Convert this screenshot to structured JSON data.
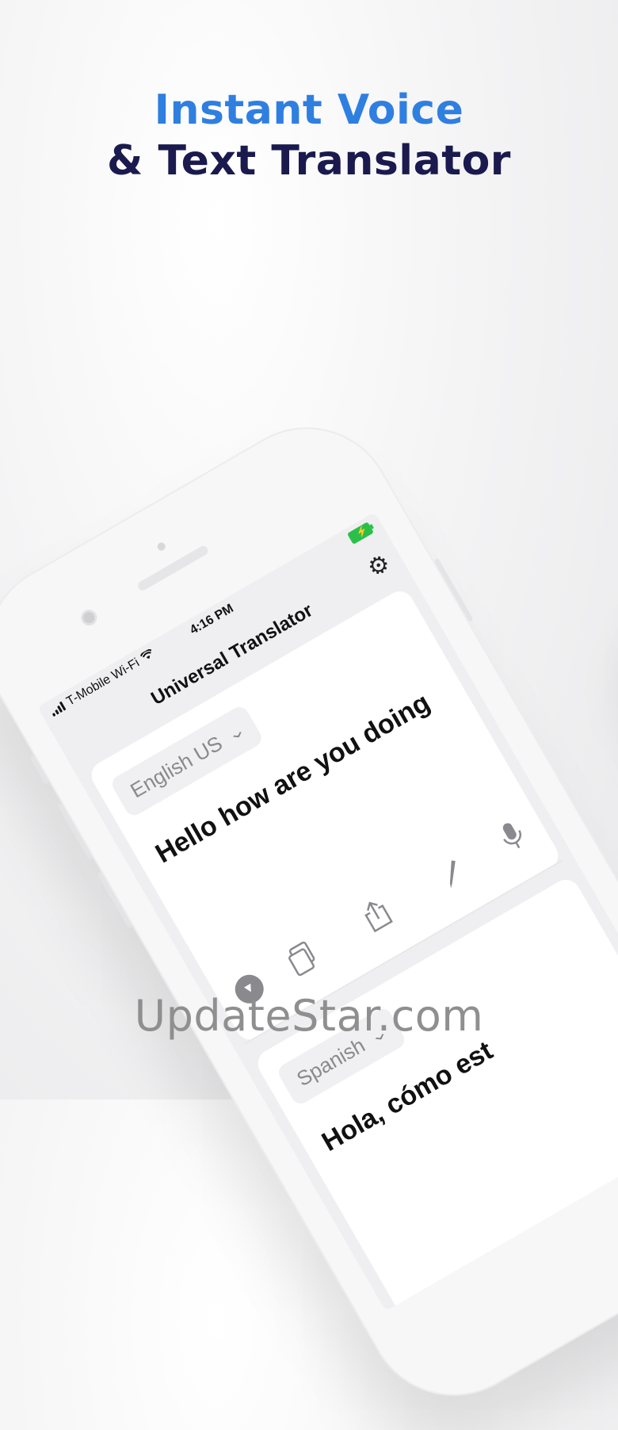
{
  "headline": {
    "line1": "Instant Voice",
    "line2": "& Text Translator"
  },
  "status_bar": {
    "carrier": "T-Mobile Wi-Fi",
    "time": "4:16 PM"
  },
  "app": {
    "title": "Universal Translator",
    "source": {
      "language": "English US",
      "text": "Hello how are you doing"
    },
    "target": {
      "language": "Spanish",
      "text": "Hola, cómo est"
    }
  },
  "icons": [
    "settings-gear-icon",
    "copy-icon",
    "share-icon",
    "edit-pencil-icon",
    "microphone-icon",
    "play-icon",
    "chevron-down-icon",
    "wifi-icon",
    "signal-bars-icon",
    "battery-icon"
  ],
  "colors": {
    "accent_blue": "#2f7fe0",
    "navy": "#1a1a4e",
    "battery_green": "#2bbf4a"
  },
  "watermark": "UpdateStar.com"
}
